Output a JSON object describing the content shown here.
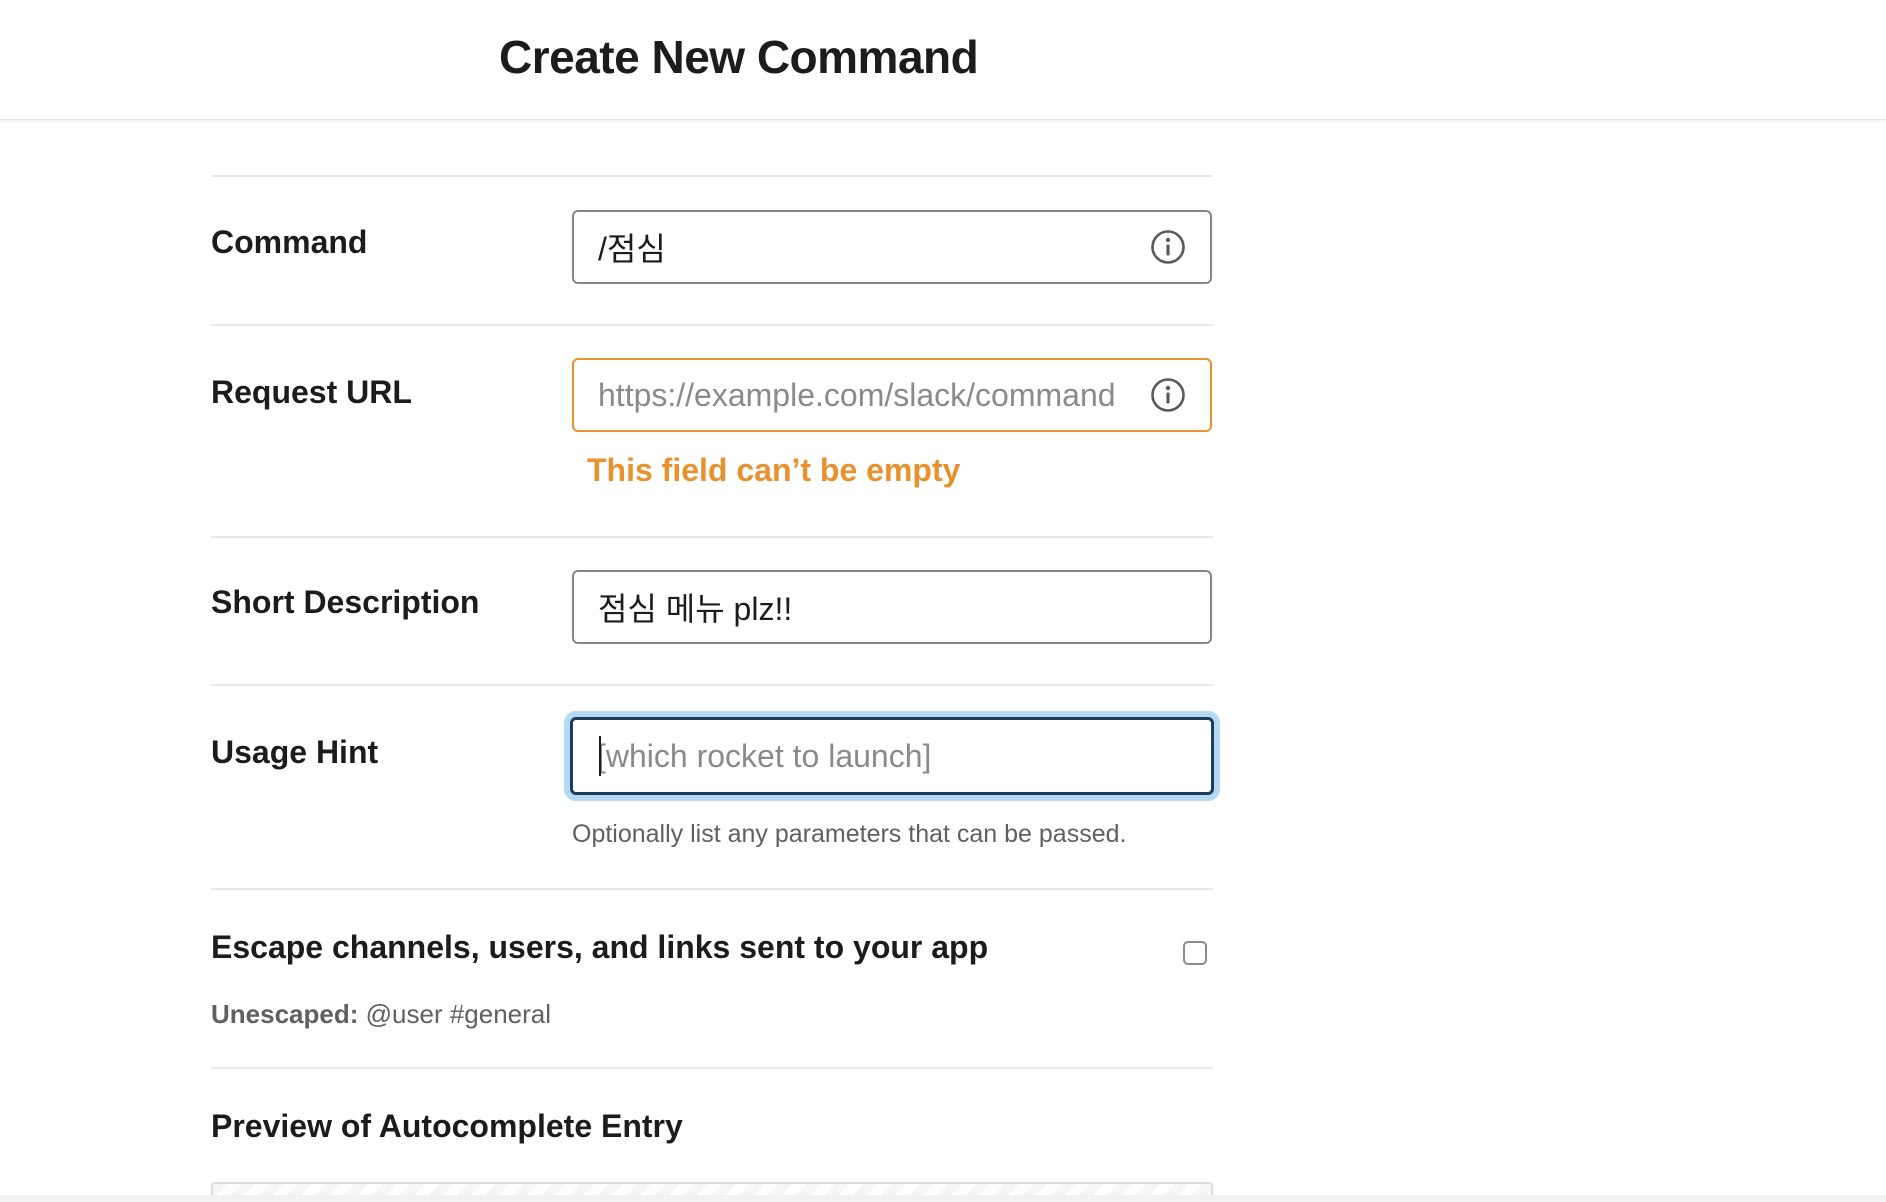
{
  "header": {
    "title": "Create New Command"
  },
  "form": {
    "command": {
      "label": "Command",
      "value": "/점심",
      "placeholder": "",
      "icon": "info-icon"
    },
    "request_url": {
      "label": "Request URL",
      "value": "",
      "placeholder": "https://example.com/slack/command",
      "icon": "info-icon",
      "error": "This field can’t be empty"
    },
    "short_description": {
      "label": "Short Description",
      "value": "점심 메뉴 plz!!",
      "placeholder": ""
    },
    "usage_hint": {
      "label": "Usage Hint",
      "value": "",
      "placeholder": "[which rocket to launch]",
      "hint": "Optionally list any parameters that can be passed."
    },
    "escape": {
      "label": "Escape channels, users, and links sent to your app",
      "checked": false,
      "unescaped_label": "Unescaped:",
      "unescaped_example": "@user #general"
    },
    "preview": {
      "label": "Preview of Autocomplete Entry"
    }
  },
  "colors": {
    "error": "#e8912d",
    "focus_border": "#1d3c5e",
    "focus_glow": "#b5d9f3",
    "border": "#868686"
  }
}
